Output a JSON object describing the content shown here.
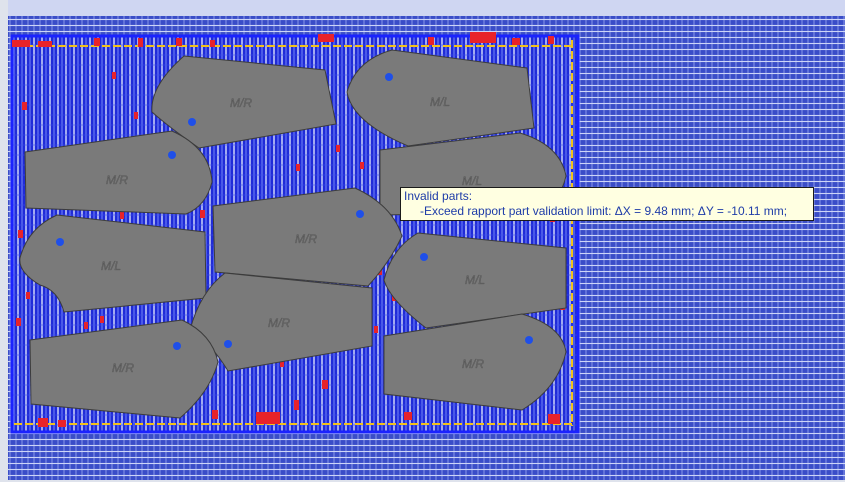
{
  "colors": {
    "fabric_base": "#2f40c9",
    "fabric_thread": "#dfe8ff",
    "rapport_bg": "#1f2bd8",
    "rapport_frame": "#f2c21a",
    "piece_fill": "#7a7a7a",
    "piece_edge": "#3c3c3c",
    "grain_dot": "#1f4fe8",
    "invalid_mark": "#e8232a",
    "tooltip_bg": "#ffffe1",
    "tooltip_text": "#1e3ca8"
  },
  "pieces": [
    {
      "id": "p1",
      "label": "M/R"
    },
    {
      "id": "p2",
      "label": "M/L"
    },
    {
      "id": "p3",
      "label": "M/R"
    },
    {
      "id": "p4",
      "label": "M/L"
    },
    {
      "id": "p5",
      "label": "M/R"
    },
    {
      "id": "p6",
      "label": "M/L"
    },
    {
      "id": "p7",
      "label": "M/L"
    },
    {
      "id": "p8",
      "label": "M/R"
    },
    {
      "id": "p9",
      "label": "M/R"
    },
    {
      "id": "p10",
      "label": "M/R"
    }
  ],
  "tooltip": {
    "title": "Invalid parts:",
    "detail": "-Exceed rapport part validation limit: ΔX = 9.48 mm; ΔY = -10.11 mm;"
  }
}
